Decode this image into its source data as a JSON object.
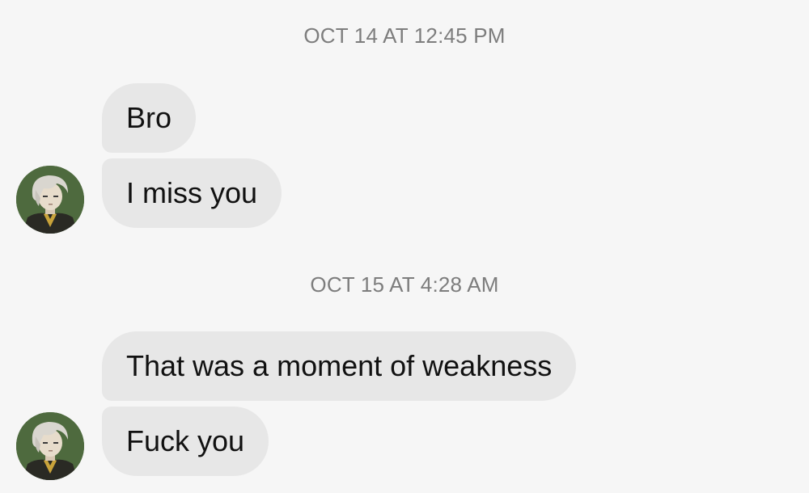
{
  "conversation": {
    "groups": [
      {
        "timestamp": "OCT 14 AT 12:45 PM",
        "messages": [
          "Bro",
          "I miss you"
        ]
      },
      {
        "timestamp": "OCT 15 AT 4:28 AM",
        "messages": [
          "That was a moment of weakness",
          "Fuck you"
        ]
      }
    ]
  },
  "avatar": {
    "icon": "user-avatar-anime-character"
  }
}
